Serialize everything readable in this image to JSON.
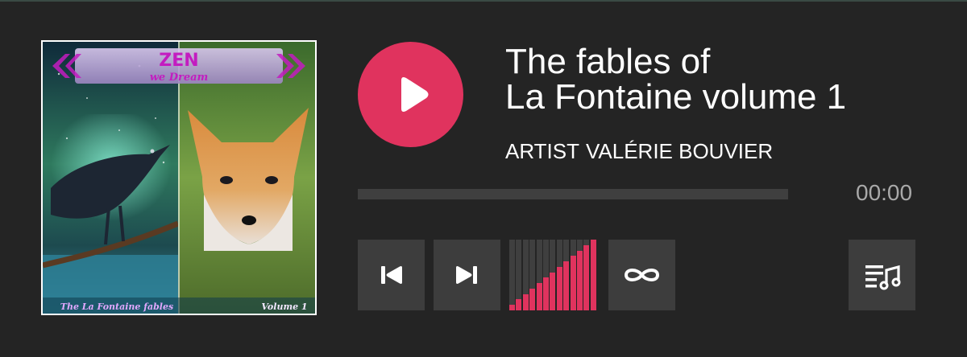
{
  "track": {
    "title_line1": "The fables of",
    "title_line2": "La Fontaine volume 1",
    "artist_label": "ARTIST",
    "artist_name": "VALÉRIE BOUVIER"
  },
  "progress": {
    "time": "00:00",
    "fraction": 0
  },
  "volume": {
    "level": 1.0,
    "bars": 13
  },
  "cover": {
    "heading": "ZEN",
    "subheading": "we Dream",
    "footer_left": "The La Fontaine fables",
    "footer_right": "Volume 1"
  },
  "icons": {
    "play": "play-icon",
    "previous": "skip-previous-icon",
    "next": "skip-next-icon",
    "loop": "infinity-loop-icon",
    "playlist": "playlist-music-icon"
  },
  "colors": {
    "accent": "#e0335e",
    "background": "#242424",
    "button": "#3d3d3d",
    "track": "#3f3f3f",
    "muted_text": "#a9a9a9"
  }
}
